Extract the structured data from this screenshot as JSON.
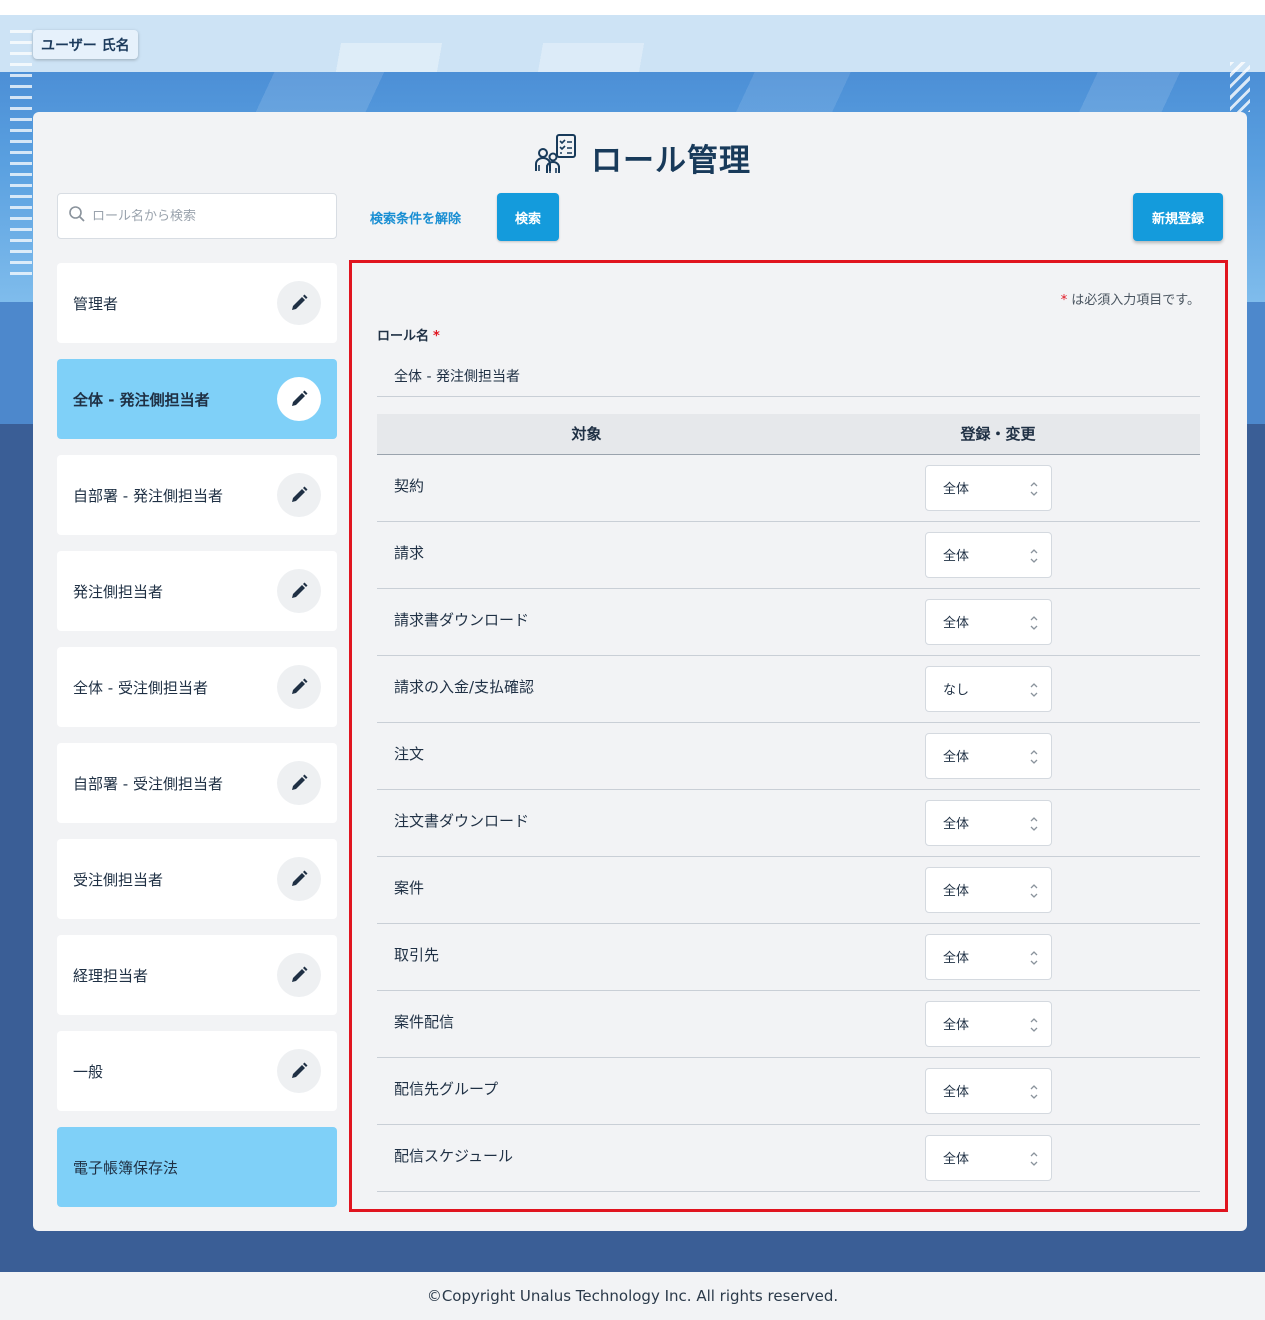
{
  "user": {
    "name": "ユーザー 氏名"
  },
  "header": {
    "title": "ロール管理",
    "icon": "team-checklist-icon"
  },
  "toolbar": {
    "search_placeholder": "ロール名から検索",
    "clear_label": "検索条件を解除",
    "search_label": "検索",
    "new_label": "新規登録"
  },
  "roles": [
    {
      "label": "管理者"
    },
    {
      "label": "全体 - 発注側担当者"
    },
    {
      "label": "自部署 - 発注側担当者"
    },
    {
      "label": "発注側担当者"
    },
    {
      "label": "全体 - 受注側担当者"
    },
    {
      "label": "自部署 - 受注側担当者"
    },
    {
      "label": "受注側担当者"
    },
    {
      "label": "経理担当者"
    },
    {
      "label": "一般"
    },
    {
      "label": "電子帳簿保存法"
    }
  ],
  "form": {
    "required_note": "は必須入力項目です。",
    "required_mark": "*",
    "role_name_label": "ロール名",
    "role_name_value": "全体 - 発注側担当者",
    "columns": {
      "target": "対象",
      "register": "登録・変更"
    },
    "rows": [
      {
        "target": "契約",
        "value": "全体"
      },
      {
        "target": "請求",
        "value": "全体"
      },
      {
        "target": "請求書ダウンロード",
        "value": "全体"
      },
      {
        "target": "請求の入金/支払確認",
        "value": "なし"
      },
      {
        "target": "注文",
        "value": "全体"
      },
      {
        "target": "注文書ダウンロード",
        "value": "全体"
      },
      {
        "target": "案件",
        "value": "全体"
      },
      {
        "target": "取引先",
        "value": "全体"
      },
      {
        "target": "案件配信",
        "value": "全体"
      },
      {
        "target": "配信先グループ",
        "value": "全体"
      },
      {
        "target": "配信スケジュール",
        "value": "全体"
      }
    ]
  },
  "footer": {
    "copyright": "©Copyright Unalus Technology Inc. All rights reserved."
  },
  "colors": {
    "accent": "#149bdc",
    "active_item": "#7fd0f8",
    "highlight_border": "#e0141f"
  }
}
